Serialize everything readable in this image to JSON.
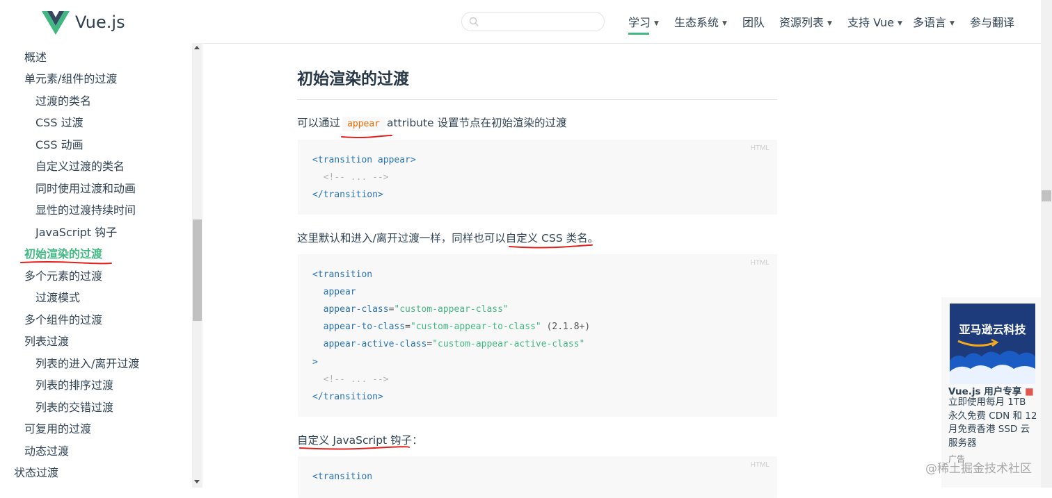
{
  "header": {
    "logo_text": "Vue.js",
    "nav": [
      {
        "label": "学习",
        "caret": "▼"
      },
      {
        "label": "生态系统",
        "caret": "▼"
      },
      {
        "label": "团队",
        "caret": ""
      },
      {
        "label": "资源列表",
        "caret": "▼"
      },
      {
        "label": "支持 Vue",
        "caret": "▼"
      },
      {
        "label": "多语言",
        "caret": "▼"
      },
      {
        "label": "参与翻译",
        "caret": ""
      }
    ],
    "search_icon": "search-icon"
  },
  "sidebar": {
    "items": [
      {
        "label": "概述",
        "level": 1
      },
      {
        "label": "单元素/组件的过渡",
        "level": 1
      },
      {
        "label": "过渡的类名",
        "level": 2
      },
      {
        "label": "CSS 过渡",
        "level": 2
      },
      {
        "label": "CSS 动画",
        "level": 2
      },
      {
        "label": "自定义过渡的类名",
        "level": 2
      },
      {
        "label": "同时使用过渡和动画",
        "level": 2
      },
      {
        "label": "显性的过渡持续时间",
        "level": 2
      },
      {
        "label": "JavaScript 钩子",
        "level": 2
      },
      {
        "label": "初始渲染的过渡",
        "level": 1,
        "active": true
      },
      {
        "label": "多个元素的过渡",
        "level": 1
      },
      {
        "label": "过渡模式",
        "level": 2
      },
      {
        "label": "多个组件的过渡",
        "level": 1
      },
      {
        "label": "列表过渡",
        "level": 1
      },
      {
        "label": "列表的进入/离开过渡",
        "level": 2
      },
      {
        "label": "列表的排序过渡",
        "level": 2
      },
      {
        "label": "列表的交错过渡",
        "level": 2
      },
      {
        "label": "可复用的过渡",
        "level": 1
      },
      {
        "label": "动态过渡",
        "level": 1
      },
      {
        "label": "状态过渡",
        "level": 0
      }
    ]
  },
  "main": {
    "title": "初始渲染的过渡",
    "para1": {
      "before": "可以通过",
      "code": "appear",
      "after": "attribute 设置节点在初始渲染的过渡"
    },
    "code1": {
      "lang": "HTML",
      "lines": [
        [
          {
            "t": "<transition ",
            "c": "tag"
          },
          {
            "t": "appear",
            "c": "attr"
          },
          {
            "t": ">",
            "c": "tag"
          }
        ],
        [
          {
            "t": "  <!-- ... -->",
            "c": "cmt"
          }
        ],
        [
          {
            "t": "</transition>",
            "c": "tag"
          }
        ]
      ]
    },
    "para2": {
      "before": "这里默认和进入/离开过渡一样，同样也可以",
      "link": "自定义 CSS 类名",
      "after": "。"
    },
    "code2": {
      "lang": "HTML",
      "lines": [
        [
          {
            "t": "<transition",
            "c": "tag"
          }
        ],
        [
          {
            "t": "  appear",
            "c": "attr"
          }
        ],
        [
          {
            "t": "  appear-class",
            "c": "attr"
          },
          {
            "t": "=",
            "c": "plain"
          },
          {
            "t": "\"custom-appear-class\"",
            "c": "str"
          }
        ],
        [
          {
            "t": "  appear-to-class",
            "c": "attr"
          },
          {
            "t": "=",
            "c": "plain"
          },
          {
            "t": "\"custom-appear-to-class\"",
            "c": "str"
          },
          {
            "t": " (2.1.8+)",
            "c": "plain"
          }
        ],
        [
          {
            "t": "  appear-active-class",
            "c": "attr"
          },
          {
            "t": "=",
            "c": "plain"
          },
          {
            "t": "\"custom-appear-active-class\"",
            "c": "str"
          }
        ],
        [
          {
            "t": ">",
            "c": "tag"
          }
        ],
        [
          {
            "t": "  <!-- ... -->",
            "c": "cmt"
          }
        ],
        [
          {
            "t": "</transition>",
            "c": "tag"
          }
        ]
      ]
    },
    "para3": {
      "link": "自定义 JavaScript 钩子",
      "after": "："
    },
    "code3": {
      "lang": "HTML",
      "lines": [
        [
          {
            "t": "<transition",
            "c": "tag"
          }
        ]
      ]
    }
  },
  "ad": {
    "image_text": "亚马逊云科技",
    "title": "Vue.js 用户专享",
    "gift_icon": "gift-icon",
    "desc": "立即使用每月 1TB 永久免费 CDN 和 12 月免费香港 SSD 云服务器",
    "small": "广告"
  },
  "watermark": "@稀土掘金技术社区",
  "colors": {
    "accent": "#42b983",
    "annotation": "#e0201b",
    "text": "#304455"
  }
}
